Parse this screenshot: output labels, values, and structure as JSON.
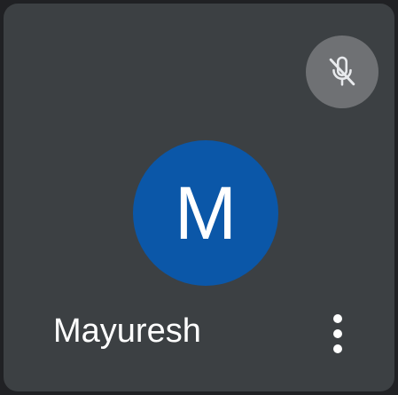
{
  "participant": {
    "name": "Mayuresh",
    "initial": "M",
    "avatar_color": "#0b57a8",
    "mic_state": "muted",
    "mic_icon": "mic-off-icon",
    "menu_icon": "more-vert-icon"
  },
  "colors": {
    "tile_background": "#3c4043",
    "page_background": "#202124",
    "mute_badge": "#6f7174",
    "text": "#ffffff"
  }
}
